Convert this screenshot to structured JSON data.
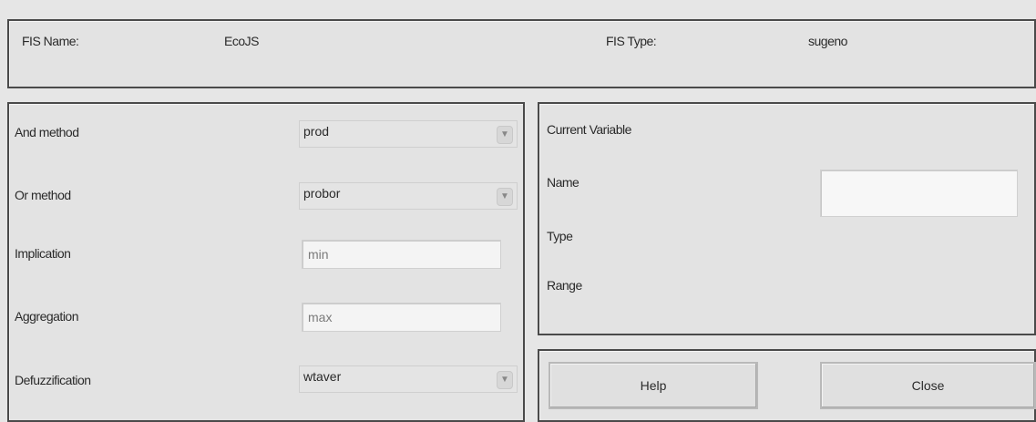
{
  "fis": {
    "name_label": "FIS Name:",
    "name_value": "EcoJS",
    "type_label": "FIS Type:",
    "type_value": "sugeno"
  },
  "methods": {
    "and_label": "And method",
    "and_value": "prod",
    "or_label": "Or method",
    "or_value": "probor",
    "implication_label": "Implication",
    "implication_value": "min",
    "aggregation_label": "Aggregation",
    "aggregation_value": "max",
    "defuzz_label": "Defuzzification",
    "defuzz_value": "wtaver"
  },
  "current_variable": {
    "heading": "Current Variable",
    "name_label": "Name",
    "name_value": "",
    "type_label": "Type",
    "range_label": "Range"
  },
  "buttons": {
    "help": "Help",
    "close": "Close"
  },
  "icons": {
    "dropdown": "chevron-down-icon"
  }
}
